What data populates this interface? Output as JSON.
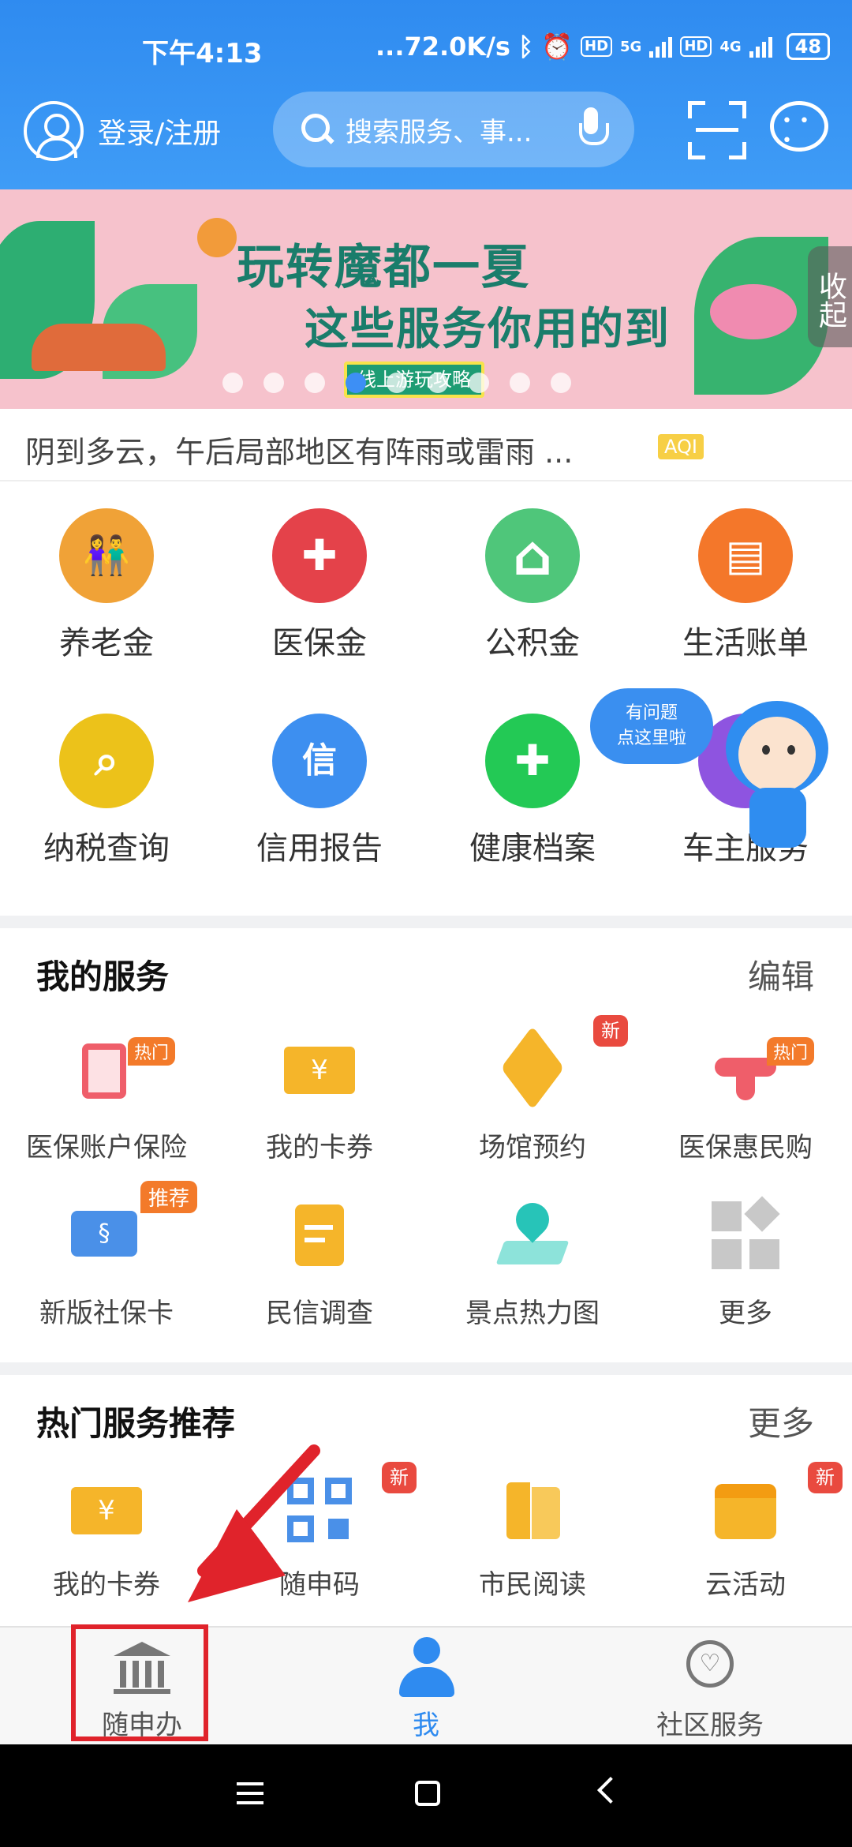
{
  "status_bar": {
    "time": "下午4:13",
    "network_speed": "...72.0K/s",
    "signal1": "5G",
    "signal2": "4G",
    "battery": "48"
  },
  "header": {
    "login_label": "登录/注册",
    "search_placeholder": "搜索服务、事..."
  },
  "banner": {
    "title_line1": "玩转魔都一夏",
    "title_line2": "这些服务你用的到",
    "button_label": "线上游玩攻略",
    "collapse_label": "收起",
    "dot_count": 10,
    "active_dot": 3
  },
  "weather": {
    "text": "阴到多云，午后局部地区有阵雨或雷雨 ...",
    "aqi_label": "AQI"
  },
  "quick_services": [
    {
      "label": "养老金",
      "color": "#f0a237",
      "icon": "elderly-icon",
      "glyph": "👫"
    },
    {
      "label": "医保金",
      "color": "#e4424a",
      "icon": "medical-cross-icon",
      "glyph": "✚"
    },
    {
      "label": "公积金",
      "color": "#4fc67a",
      "icon": "house-icon",
      "glyph": "⌂"
    },
    {
      "label": "生活账单",
      "color": "#f4772a",
      "icon": "bill-icon",
      "glyph": "▤"
    },
    {
      "label": "纳税查询",
      "color": "#ecc21a",
      "icon": "tax-search-icon",
      "glyph": "⌕"
    },
    {
      "label": "信用报告",
      "color": "#3d8ff0",
      "icon": "credit-icon",
      "glyph": "信"
    },
    {
      "label": "健康档案",
      "color": "#23c955",
      "icon": "health-record-icon",
      "glyph": "✚"
    },
    {
      "label": "车主服务",
      "color": "#8e54e0",
      "icon": "car-service-icon",
      "glyph": "⚙"
    }
  ],
  "assistant": {
    "bubble_line1": "有问题",
    "bubble_line2": "点这里啦"
  },
  "my_services": {
    "title": "我的服务",
    "action": "编辑",
    "items": [
      {
        "label": "医保账户保险",
        "tag": "热门",
        "color": "#ef5e6a",
        "icon": "insurance-icon"
      },
      {
        "label": "我的卡券",
        "tag": "",
        "color": "#f5b52a",
        "icon": "coupon-icon"
      },
      {
        "label": "场馆预约",
        "tag": "新",
        "color": "#f5b52a",
        "icon": "venue-box-icon"
      },
      {
        "label": "医保惠民购",
        "tag": "热门",
        "color": "#ef5e6a",
        "icon": "medical-shop-icon"
      },
      {
        "label": "新版社保卡",
        "tag": "推荐",
        "color": "#4a90e8",
        "icon": "social-card-icon"
      },
      {
        "label": "民信调查",
        "tag": "",
        "color": "#f5b52a",
        "icon": "survey-clipboard-icon"
      },
      {
        "label": "景点热力图",
        "tag": "",
        "color": "#27c4b8",
        "icon": "map-pin-icon"
      },
      {
        "label": "更多",
        "tag": "",
        "color": "#c8c8c8",
        "icon": "more-grid-icon"
      }
    ]
  },
  "hot_services": {
    "title": "热门服务推荐",
    "action": "更多",
    "items": [
      {
        "label": "我的卡券",
        "tag": "",
        "color": "#f5b52a",
        "icon": "coupon-icon"
      },
      {
        "label": "随申码",
        "tag": "新",
        "color": "#4a90e8",
        "icon": "qr-code-icon"
      },
      {
        "label": "市民阅读",
        "tag": "",
        "color": "#f5b52a",
        "icon": "book-icon"
      },
      {
        "label": "云活动",
        "tag": "新",
        "color": "#f5b52a",
        "icon": "calendar-icon"
      }
    ]
  },
  "bottom_nav": [
    {
      "label": "随申办",
      "icon": "government-building-icon",
      "active": false
    },
    {
      "label": "我",
      "icon": "person-icon",
      "active": true
    },
    {
      "label": "社区服务",
      "icon": "community-heart-icon",
      "active": false
    }
  ],
  "colors": {
    "header": "#2f8bf0",
    "accent": "#3d8ff5",
    "highlight": "#e0232b"
  }
}
